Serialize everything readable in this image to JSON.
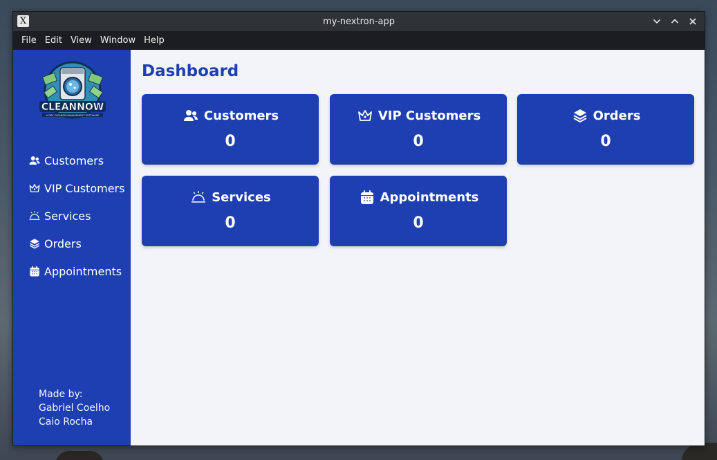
{
  "window": {
    "title": "my-nextron-app",
    "app_icon_glyph": "X"
  },
  "menubar": {
    "items": [
      "File",
      "Edit",
      "View",
      "Window",
      "Help"
    ]
  },
  "sidebar": {
    "logo_text": "CLEANNOW",
    "logo_subtext": "A DRY CLEANER MANAGEMENT SOFTWARE",
    "items": [
      {
        "label": "Customers",
        "icon": "users-icon"
      },
      {
        "label": "VIP Customers",
        "icon": "crown-icon"
      },
      {
        "label": "Services",
        "icon": "service-bell-icon"
      },
      {
        "label": "Orders",
        "icon": "layers-icon"
      },
      {
        "label": "Appointments",
        "icon": "calendar-icon"
      }
    ],
    "credits": {
      "heading": "Made by:",
      "authors": [
        "Gabriel Coelho",
        "Caio Rocha"
      ]
    }
  },
  "main": {
    "title": "Dashboard",
    "cards": [
      {
        "label": "Customers",
        "value": "0",
        "icon": "users-icon"
      },
      {
        "label": "VIP Customers",
        "value": "0",
        "icon": "crown-icon"
      },
      {
        "label": "Orders",
        "value": "0",
        "icon": "layers-icon"
      },
      {
        "label": "Services",
        "value": "0",
        "icon": "service-bell-icon"
      },
      {
        "label": "Appointments",
        "value": "0",
        "icon": "calendar-icon"
      }
    ]
  },
  "colors": {
    "primary": "#1e3fb2",
    "background": "#f3f4f7",
    "titlebar": "#2f3338",
    "menubar": "#1b1d20"
  }
}
